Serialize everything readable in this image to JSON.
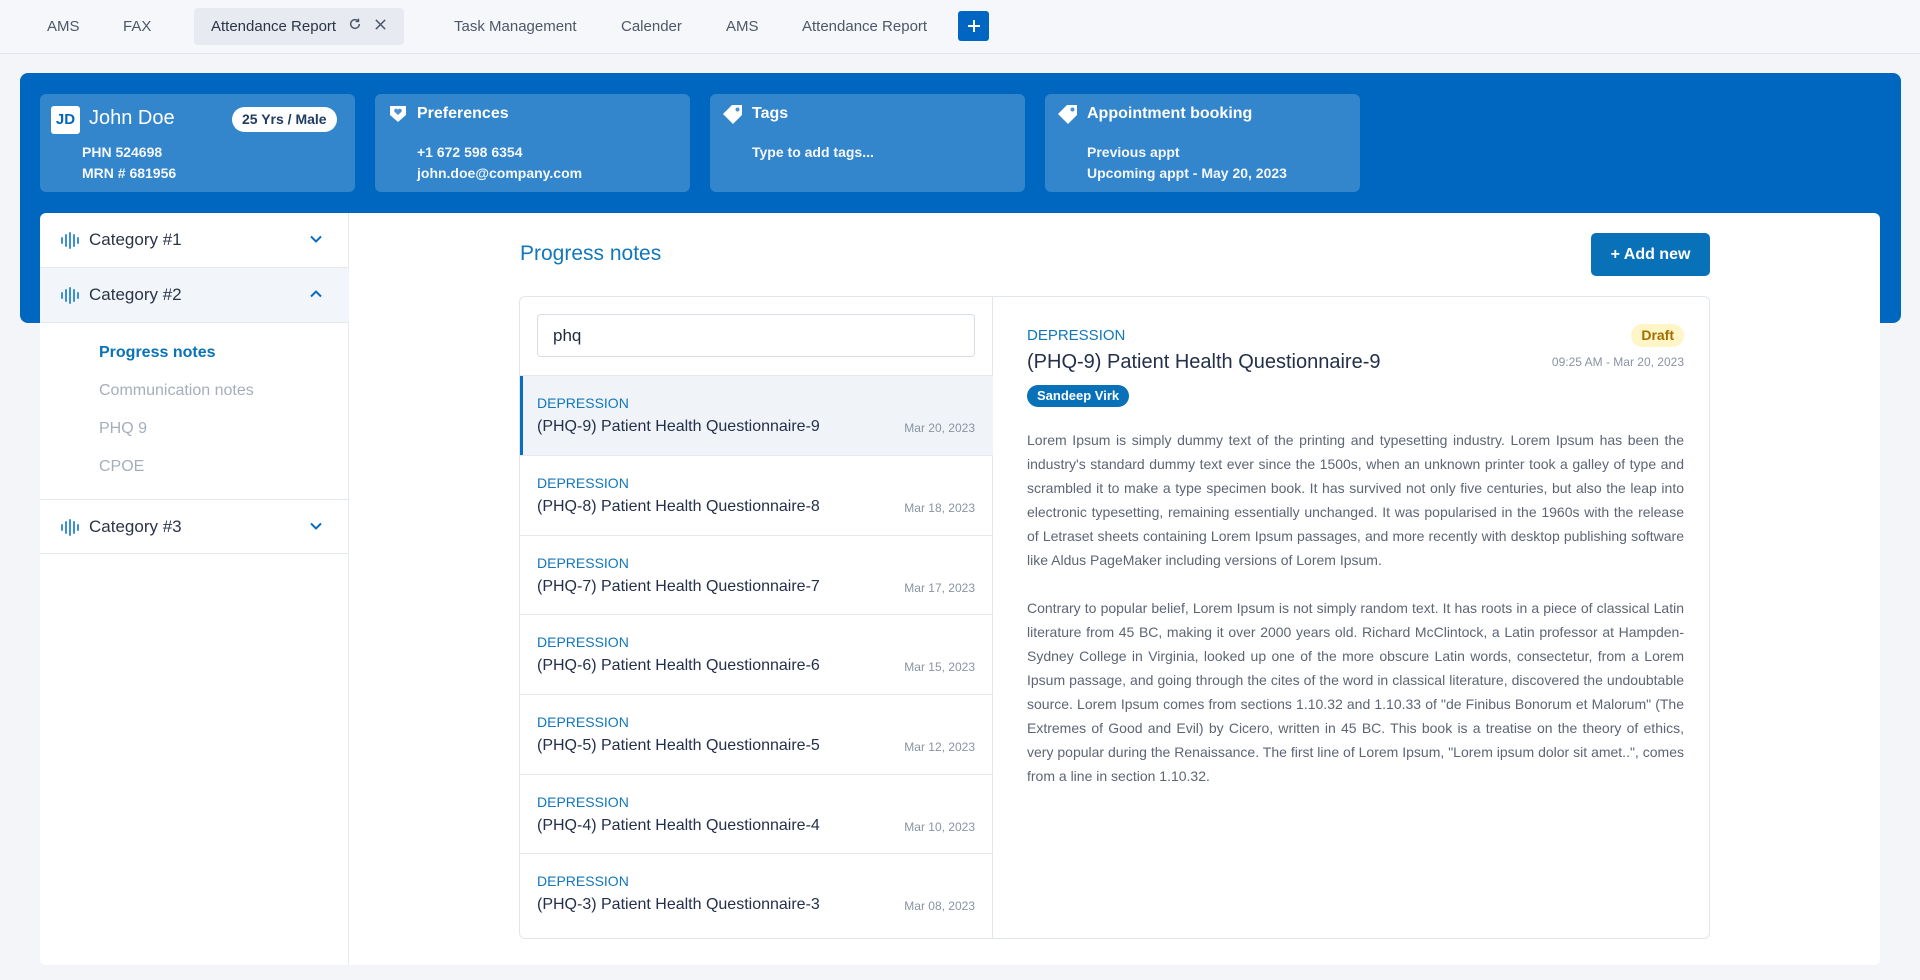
{
  "tabs": [
    {
      "label": "AMS"
    },
    {
      "label": "FAX"
    },
    {
      "label": "Attendance Report"
    },
    {
      "label": "Task Management"
    },
    {
      "label": "Calender"
    },
    {
      "label": "AMS"
    },
    {
      "label": "Attendance Report"
    }
  ],
  "patient": {
    "initials": "JD",
    "name": "John Doe",
    "age_sex": "25 Yrs / Male",
    "phn": "PHN 524698",
    "mrn": "MRN # 681956"
  },
  "preferences": {
    "title": "Preferences",
    "phone": "+1 672 598 6354",
    "email": "john.doe@company.com"
  },
  "tags": {
    "title": "Tags",
    "placeholder": "Type to add tags..."
  },
  "appointment": {
    "title": "Appointment booking",
    "previous": "Previous appt",
    "upcoming": "Upcoming appt - May 20, 2023"
  },
  "sidebar": {
    "cat1": "Category #1",
    "cat2": "Category #2",
    "cat3": "Category #3",
    "sub": [
      "Progress notes",
      "Communication notes",
      "PHQ 9",
      "CPOE"
    ]
  },
  "main": {
    "title": "Progress notes",
    "add_label": "+ Add new",
    "search_value": "phq"
  },
  "notes": [
    {
      "category": "DEPRESSION",
      "title": "(PHQ-9) Patient Health Questionnaire-9",
      "date": "Mar 20, 2023"
    },
    {
      "category": "DEPRESSION",
      "title": "(PHQ-8) Patient Health Questionnaire-8",
      "date": "Mar 18, 2023"
    },
    {
      "category": "DEPRESSION",
      "title": "(PHQ-7) Patient Health Questionnaire-7",
      "date": "Mar 17, 2023"
    },
    {
      "category": "DEPRESSION",
      "title": "(PHQ-6) Patient Health Questionnaire-6",
      "date": "Mar 15, 2023"
    },
    {
      "category": "DEPRESSION",
      "title": "(PHQ-5) Patient Health Questionnaire-5",
      "date": "Mar 12, 2023"
    },
    {
      "category": "DEPRESSION",
      "title": "(PHQ-4) Patient Health Questionnaire-4",
      "date": "Mar 10, 2023"
    },
    {
      "category": "DEPRESSION",
      "title": "(PHQ-3) Patient Health Questionnaire-3",
      "date": "Mar 08, 2023"
    }
  ],
  "detail": {
    "category": "DEPRESSION",
    "title": "(PHQ-9) Patient Health Questionnaire-9",
    "status": "Draft",
    "time": "09:25 AM - Mar 20, 2023",
    "author": "Sandeep Virk",
    "para1": "Lorem Ipsum is simply dummy text of the printing and typesetting industry. Lorem Ipsum has been the industry's standard dummy text ever since the 1500s, when an unknown printer took a galley of type and scrambled it to make a type specimen book. It has survived not only five centuries, but also the leap into electronic typesetting, remaining essentially unchanged. It was popularised in the 1960s with the release of Letraset sheets containing Lorem Ipsum passages, and more recently with desktop publishing software like Aldus PageMaker including versions of Lorem Ipsum.",
    "para2": "Contrary to popular belief, Lorem Ipsum is not simply random text. It has roots in a piece of classical Latin literature from 45 BC, making it over 2000 years old. Richard McClintock, a Latin professor at Hampden-Sydney College in Virginia, looked up one of the more obscure Latin words, consectetur, from a Lorem Ipsum passage, and going through the cites of the word in classical literature, discovered the undoubtable source. Lorem Ipsum comes from sections 1.10.32 and 1.10.33 of \"de Finibus Bonorum et Malorum\" (The Extremes of Good and Evil) by Cicero, written in 45 BC. This book is a treatise on the theory of ethics, very popular during the Renaissance. The first line of Lorem Ipsum, \"Lorem ipsum dolor sit amet..\", comes from a line in section 1.10.32."
  },
  "icons": {
    "refresh": "refresh-icon",
    "close": "close-icon",
    "add": "plus-icon",
    "preferences": "hand-heart-icon",
    "tags": "tag-icon",
    "appointment": "tag-icon",
    "category": "waveform-icon",
    "chevron": "chevron-icon"
  },
  "colors": {
    "brand": "#0067c0",
    "accent": "#1177b9",
    "draft_bg": "#fff5c7",
    "draft_text": "#a36d00"
  }
}
